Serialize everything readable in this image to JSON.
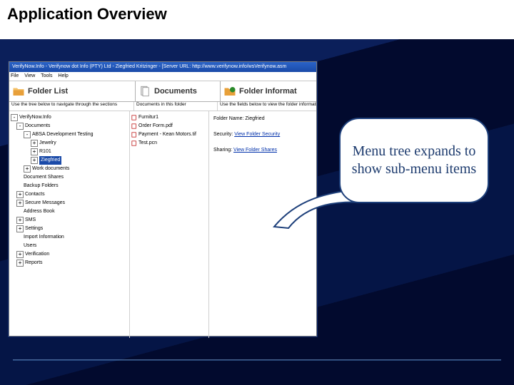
{
  "slide": {
    "title": "Application Overview"
  },
  "window": {
    "titlebar": "VerifyNow.Info - Verifynow dot Info (PTY) Ltd - Ziegfried Kritzinger - [Server URL: http://www.verifynow.info/wsVerifynow.asm",
    "menubar": [
      "File",
      "View",
      "Tools",
      "Help"
    ],
    "panels": [
      {
        "label": "Folder List",
        "icon": "folder"
      },
      {
        "label": "Documents",
        "icon": "docs"
      },
      {
        "label": "Folder Informat",
        "icon": "folderinfo"
      }
    ],
    "subheaders": [
      "Use the tree below to navigate through the sections",
      "Documents in this folder",
      "Use the fields below to view the folder information"
    ],
    "tree": [
      {
        "pm": "-",
        "text": "VerifyNow.Info",
        "ind": 0
      },
      {
        "pm": "-",
        "text": "Documents",
        "ind": 1
      },
      {
        "pm": "-",
        "text": "ABSA Development Testing",
        "ind": 2
      },
      {
        "pm": "+",
        "text": "Jewelry",
        "ind": 3
      },
      {
        "pm": "+",
        "text": "R101",
        "ind": 3
      },
      {
        "pm": "+",
        "text": "Ziegfried",
        "ind": 3,
        "selected": true
      },
      {
        "pm": "+",
        "text": "Work documents",
        "ind": 2
      },
      {
        "pm": "",
        "text": "Document Shares",
        "ind": 1
      },
      {
        "pm": "",
        "text": "Backup Folders",
        "ind": 1
      },
      {
        "pm": "+",
        "text": "Contacts",
        "ind": 1
      },
      {
        "pm": "+",
        "text": "Secure Messages",
        "ind": 1
      },
      {
        "pm": "",
        "text": "Address Book",
        "ind": 1
      },
      {
        "pm": "+",
        "text": "SMS",
        "ind": 1
      },
      {
        "pm": "+",
        "text": "Settings",
        "ind": 1
      },
      {
        "pm": "",
        "text": "Import Information",
        "ind": 1
      },
      {
        "pm": "",
        "text": "Users",
        "ind": 1
      },
      {
        "pm": "+",
        "text": "Verification",
        "ind": 1
      },
      {
        "pm": "+",
        "text": "Reports",
        "ind": 1
      }
    ],
    "documents": [
      "Furnitur1",
      "Order Form.pdf",
      "Payment - Kean Motors.tif",
      "Test.pcn"
    ],
    "info": {
      "folder_name_label": "Folder Name:",
      "folder_name_value": "Ziegfried",
      "security_label": "Security:",
      "security_link": "View Folder Security",
      "sharing_label": "Sharing:",
      "sharing_link": "View Folder Shares"
    }
  },
  "callout": {
    "text": "Menu tree expands to show sub-menu items"
  }
}
